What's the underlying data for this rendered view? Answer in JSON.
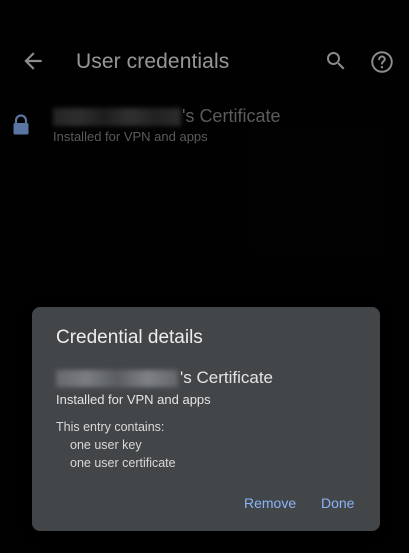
{
  "appbar": {
    "title": "User credentials",
    "back_icon": "arrow-back-icon",
    "search_icon": "search-icon",
    "help_icon": "help-icon"
  },
  "credential_item": {
    "title_suffix": "'s Certificate",
    "subtitle": "Installed for VPN and apps",
    "icon": "lock-icon"
  },
  "dialog": {
    "title": "Credential details",
    "name_suffix": "'s Certificate",
    "installed": "Installed for VPN and apps",
    "contains_label": "This entry contains:",
    "entries": [
      "one user key",
      "one user certificate"
    ],
    "remove_label": "Remove",
    "done_label": "Done"
  },
  "colors": {
    "background": "#030303",
    "dialog": "#434649",
    "accent": "#8ab4f8"
  }
}
